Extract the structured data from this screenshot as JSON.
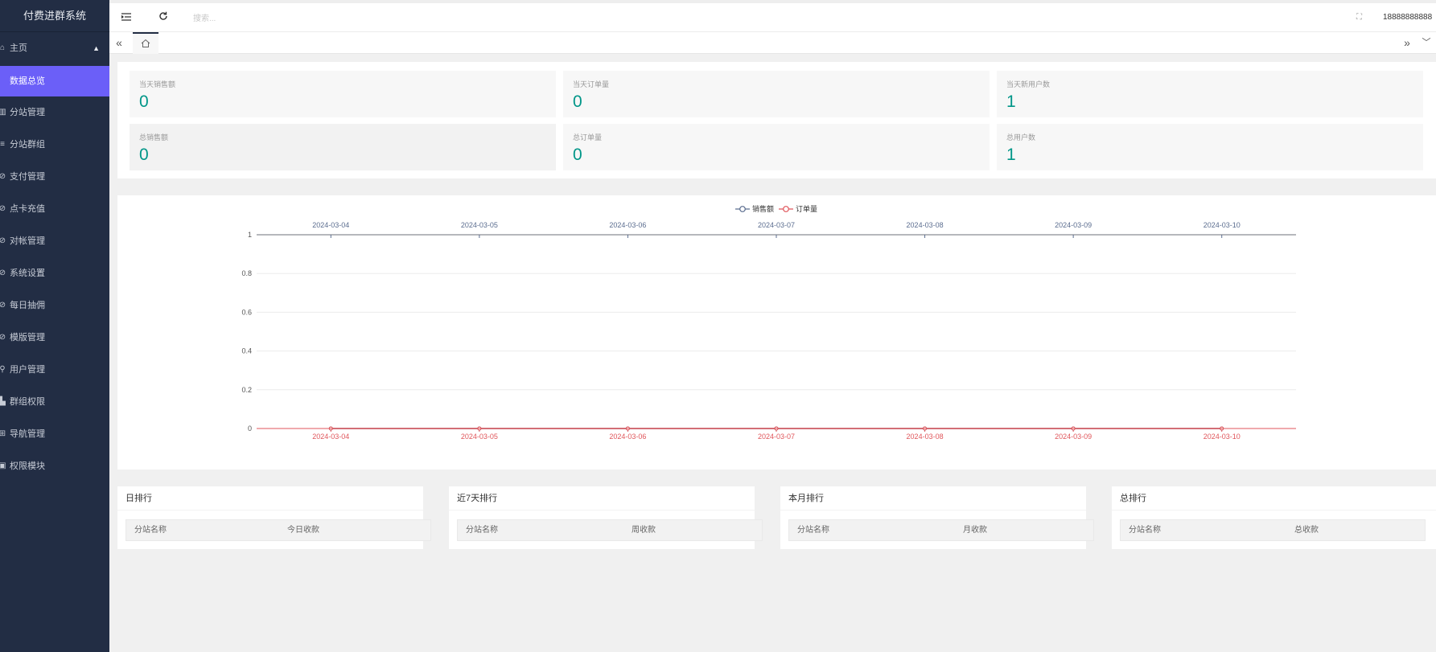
{
  "app_title": "付费进群系统",
  "sidebar": {
    "items": [
      {
        "label": "主页",
        "icon": "home-icon",
        "glyph": "⌂"
      },
      {
        "label": "数据总览",
        "icon": "",
        "glyph": ""
      },
      {
        "label": "分站管理",
        "icon": "columns-icon",
        "glyph": "▥"
      },
      {
        "label": "分站群组",
        "icon": "list-icon",
        "glyph": "≡"
      },
      {
        "label": "支付管理",
        "icon": "settings-icon",
        "glyph": "⊘"
      },
      {
        "label": "点卡充值",
        "icon": "settings-icon",
        "glyph": "⊘"
      },
      {
        "label": "对帐管理",
        "icon": "settings-icon",
        "glyph": "⊘"
      },
      {
        "label": "系统设置",
        "icon": "settings-icon",
        "glyph": "⊘"
      },
      {
        "label": "每日抽佣",
        "icon": "settings-icon",
        "glyph": "⊘"
      },
      {
        "label": "模版管理",
        "icon": "settings-icon",
        "glyph": "⊘"
      },
      {
        "label": "用户管理",
        "icon": "user-icon",
        "glyph": "⚲"
      },
      {
        "label": "群组权限",
        "icon": "group-icon",
        "glyph": "▙"
      },
      {
        "label": "导航管理",
        "icon": "nav-icon",
        "glyph": "⊞"
      },
      {
        "label": "权限模块",
        "icon": "module-icon",
        "glyph": "▣"
      }
    ]
  },
  "header": {
    "search_placeholder": "搜索...",
    "user": "18888888888",
    "menu_icon": "menu-fold-icon",
    "refresh_icon": "refresh-icon",
    "fullscreen_icon": "fullscreen-icon"
  },
  "tabs": {
    "left_arrow": "«",
    "right_arrow": "»",
    "dropdown": "﹀",
    "home_tab_icon": "home-icon"
  },
  "stats": [
    {
      "label": "当天销售额",
      "value": "0"
    },
    {
      "label": "当天订单量",
      "value": "0"
    },
    {
      "label": "当天新用户数",
      "value": "1"
    },
    {
      "label": "总销售额",
      "value": "0"
    },
    {
      "label": "总订单量",
      "value": "0"
    },
    {
      "label": "总用户数",
      "value": "1"
    }
  ],
  "chart_data": {
    "type": "line",
    "categories": [
      "2024-03-04",
      "2024-03-05",
      "2024-03-06",
      "2024-03-07",
      "2024-03-08",
      "2024-03-09",
      "2024-03-10"
    ],
    "series": [
      {
        "name": "销售额",
        "values": [
          0,
          0,
          0,
          0,
          0,
          0,
          0
        ],
        "color": "#5b6d8f"
      },
      {
        "name": "订单量",
        "values": [
          0,
          0,
          0,
          0,
          0,
          0,
          0
        ],
        "color": "#e0565b"
      }
    ],
    "yticks": [
      "0",
      "0.2",
      "0.4",
      "0.6",
      "0.8",
      "1"
    ],
    "ylim": [
      0,
      1
    ],
    "legend": "top-center",
    "grid": true
  },
  "rankings": [
    {
      "title": "日排行",
      "col1": "分站名称",
      "col2": "今日收款"
    },
    {
      "title": "近7天排行",
      "col1": "分站名称",
      "col2": "周收款"
    },
    {
      "title": "本月排行",
      "col1": "分站名称",
      "col2": "月收款"
    },
    {
      "title": "总排行",
      "col1": "分站名称",
      "col2": "总收款"
    }
  ]
}
